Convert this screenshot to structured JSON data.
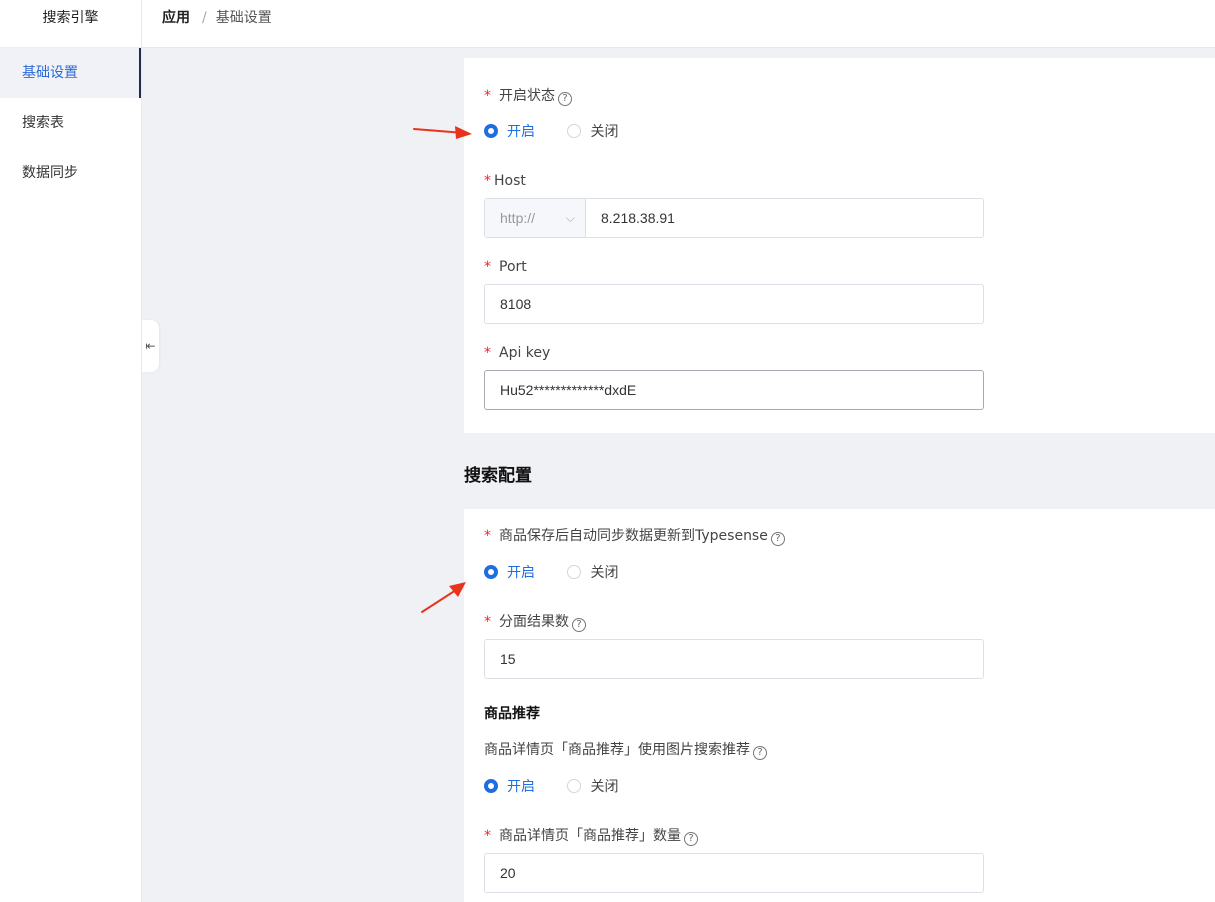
{
  "sidebar": {
    "title": "搜索引擎",
    "items": [
      {
        "label": "基础设置"
      },
      {
        "label": "搜索表"
      },
      {
        "label": "数据同步"
      }
    ]
  },
  "breadcrumb": {
    "root": "应用",
    "sep": "/",
    "current": "基础设置"
  },
  "collapse_glyph": "⇤",
  "help_glyph": "?",
  "colors": {
    "accent": "#1f6de0",
    "required": "#f5222d",
    "arrow": "#e8341c"
  },
  "basic": {
    "status": {
      "label": "开启状态",
      "on": "开启",
      "off": "关闭",
      "selected": "开启"
    },
    "host": {
      "label": "Host",
      "protocol": "http://",
      "protocol_chevron": "⌵",
      "value": "8.218.38.91"
    },
    "port": {
      "label": "Port",
      "value": "8108"
    },
    "api_key": {
      "label": "Api key",
      "value": "Hu52*************dxdE"
    }
  },
  "search_config": {
    "title": "搜索配置",
    "auto_sync": {
      "label": "商品保存后自动同步数据更新到Typesense",
      "on": "开启",
      "off": "关闭",
      "selected": "开启"
    },
    "facet_count": {
      "label": "分面结果数",
      "value": "15"
    },
    "recommend": {
      "title": "商品推荐",
      "image_search": {
        "label": "商品详情页「商品推荐」使用图片搜索推荐",
        "on": "开启",
        "off": "关闭",
        "selected": "开启"
      },
      "count": {
        "label": "商品详情页「商品推荐」数量",
        "value": "20"
      }
    }
  }
}
